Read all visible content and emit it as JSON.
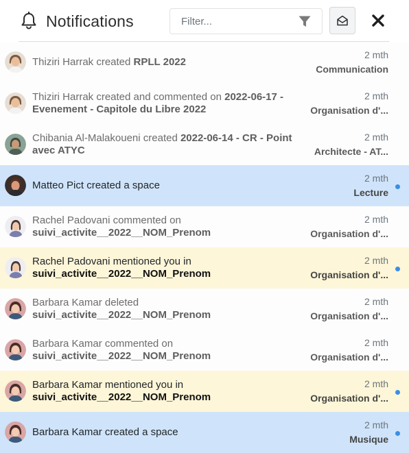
{
  "header": {
    "title": "Notifications",
    "filter_placeholder": "Filter..."
  },
  "colors": {
    "space_bg": "#cfe4fa",
    "mention_bg": "#fdf6d8",
    "unread_dot": "#3a8ee6"
  },
  "notifications": [
    {
      "actor_action": "Thiziri Harrak created ",
      "target": "RPLL 2022",
      "time": "2 mth",
      "space": "Communication",
      "unread": false,
      "kind": "read"
    },
    {
      "actor_action": "Thiziri Harrak created and commented on ",
      "target": "2022-06-17 - Evenement - Capitole du Libre 2022",
      "time": "2 mth",
      "space": "Organisation d'...",
      "unread": false,
      "kind": "read"
    },
    {
      "actor_action": "Chibania Al-Malakoueni created ",
      "target": "2022-06-14 - CR - Point avec ATYC",
      "time": "2 mth",
      "space": "Architecte - AT...",
      "unread": false,
      "kind": "read"
    },
    {
      "actor_action": "Matteo Pict created a space",
      "target": "",
      "time": "2 mth",
      "space": "Lecture",
      "unread": true,
      "kind": "space"
    },
    {
      "actor_action": "Rachel Padovani commented on",
      "target": "suivi_activite__2022__NOM_Prenom",
      "time": "2 mth",
      "space": "Organisation d'...",
      "unread": false,
      "kind": "read"
    },
    {
      "actor_action": "Rachel Padovani mentioned you in",
      "target": "suivi_activite__2022__NOM_Prenom",
      "time": "2 mth",
      "space": "Organisation d'...",
      "unread": true,
      "kind": "mention"
    },
    {
      "actor_action": "Barbara Kamar deleted",
      "target": "suivi_activite__2022__NOM_Prenom",
      "time": "2 mth",
      "space": "Organisation d'...",
      "unread": false,
      "kind": "read"
    },
    {
      "actor_action": "Barbara Kamar commented on",
      "target": "suivi_activite__2022__NOM_Prenom",
      "time": "2 mth",
      "space": "Organisation d'...",
      "unread": false,
      "kind": "read"
    },
    {
      "actor_action": "Barbara Kamar mentioned you in",
      "target": "suivi_activite__2022__NOM_Prenom",
      "time": "2 mth",
      "space": "Organisation d'...",
      "unread": true,
      "kind": "mention"
    },
    {
      "actor_action": "Barbara Kamar created a space",
      "target": "",
      "time": "2 mth",
      "space": "Musique",
      "unread": true,
      "kind": "space"
    }
  ]
}
